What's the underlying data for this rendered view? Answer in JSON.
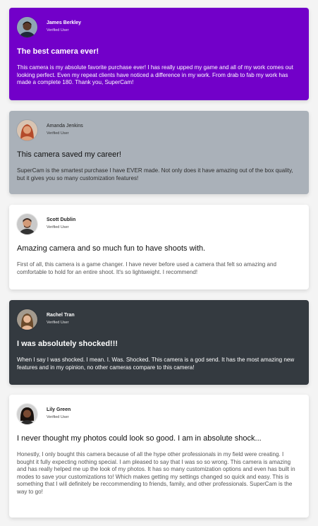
{
  "testimonials": [
    {
      "name": "James Berkley",
      "badge": "Verified User",
      "title": "The best camera ever!",
      "text": "This camera is my absolute favorite purchase ever! I has really upped my game and all of my work comes out looking perfect. Even my repeat clients have noticed a difference in my work. From drab to fab my work has made a complete 180. Thank you, SuperCam!",
      "avatar": {
        "bg": "#8fa6b4",
        "skin": "#5a3a2a",
        "hair": "#1b120d"
      }
    },
    {
      "name": "Amanda Jenkins",
      "badge": "Verified User",
      "title": "This camera saved my career!",
      "text": "SuperCam is the smartest purchase I have EVER made. Not only does it have amazing out of the box quality, but it gives you so many customization features!",
      "avatar": {
        "bg": "#d9c4b2",
        "skin": "#e0a07a",
        "hair": "#b44a2a"
      }
    },
    {
      "name": "Scott Dublin",
      "badge": "Verified User",
      "title": "Amazing camera and so much fun to have shoots with.",
      "text": "First of all, this camera is a game changer. I have never before used a camera that felt so amazing and comfortable to hold for an entire shoot. It's so lightweight. I recommend!",
      "avatar": {
        "bg": "#c9c9c9",
        "skin": "#d29a78",
        "hair": "#3a2a22"
      }
    },
    {
      "name": "Rachel Tran",
      "badge": "Verified User",
      "title": "I was absolutely shocked!!!",
      "text": "When I say I was shocked. I mean. I. Was. Shocked. This camera is a god send. It has the most amazing new features and in my opinion, no other cameras compare to this camera!",
      "avatar": {
        "bg": "#a39a8e",
        "skin": "#e6b897",
        "hair": "#6b4a2b"
      }
    },
    {
      "name": "Lily Green",
      "badge": "Verified User",
      "title": "I never thought my photos could look so good. I am in absolute shock...",
      "text": "Honestly, I only bought this camera because of all the hype other professionals in my field were creating. I bought it fully expecting nothing special. I am pleased to say that I was so so wrong. This camera is amazing and has really helped me up the look of my photos. It has so many customization options and even has built in modes to save your customizations to! Which makes getting my settings changed so quick and easy. This is something that I will definitely be reccommending to friends, family, and other professionals. SuperCam is the way to go!",
      "avatar": {
        "bg": "#d1d1d1",
        "skin": "#7a4a32",
        "hair": "#1a120e"
      }
    }
  ],
  "colors": {
    "card1": "#7200c9",
    "card2": "#aab1b9",
    "card3": "#ffffff",
    "card4": "#343a40",
    "card5": "#ffffff",
    "page": "#f4f4f4"
  }
}
